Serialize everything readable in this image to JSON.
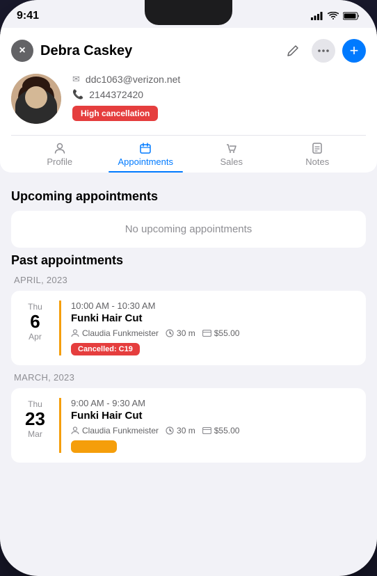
{
  "status_bar": {
    "time": "9:41"
  },
  "header": {
    "name": "Debra Caskey",
    "email": "ddc1063@verizon.net",
    "phone": "2144372420",
    "cancellation_badge": "High cancellation",
    "close_label": "×",
    "add_label": "+",
    "edit_label": "✎",
    "more_label": "•••"
  },
  "tabs": [
    {
      "id": "profile",
      "label": "Profile",
      "icon": "👤",
      "active": false
    },
    {
      "id": "appointments",
      "label": "Appointments",
      "icon": "📅",
      "active": true
    },
    {
      "id": "sales",
      "label": "Sales",
      "icon": "🛒",
      "active": false
    },
    {
      "id": "notes",
      "label": "Notes",
      "icon": "💬",
      "active": false
    }
  ],
  "upcoming": {
    "title": "Upcoming appointments",
    "empty_text": "No upcoming appointments"
  },
  "past": {
    "title": "Past appointments",
    "sections": [
      {
        "month_label": "APRIL, 2023",
        "appointments": [
          {
            "day_name": "Thu",
            "day_num": "6",
            "month": "Apr",
            "time": "10:00 AM - 10:30 AM",
            "service": "Funki Hair Cut",
            "staff": "Claudia Funkmeister",
            "duration": "30 m",
            "price": "$55.00",
            "status_badge": "Cancelled: C19",
            "badge_color": "red",
            "border_color": "#f59e0b"
          }
        ]
      },
      {
        "month_label": "MARCH, 2023",
        "appointments": [
          {
            "day_name": "Thu",
            "day_num": "23",
            "month": "Mar",
            "time": "9:00 AM - 9:30 AM",
            "service": "Funki Hair Cut",
            "staff": "Claudia Funkmeister",
            "duration": "30 m",
            "price": "$55.00",
            "status_badge": "",
            "badge_color": "yellow",
            "border_color": "#f59e0b"
          }
        ]
      }
    ]
  },
  "colors": {
    "accent_blue": "#007aff",
    "red_badge": "#e53e3e",
    "yellow": "#f59e0b"
  }
}
